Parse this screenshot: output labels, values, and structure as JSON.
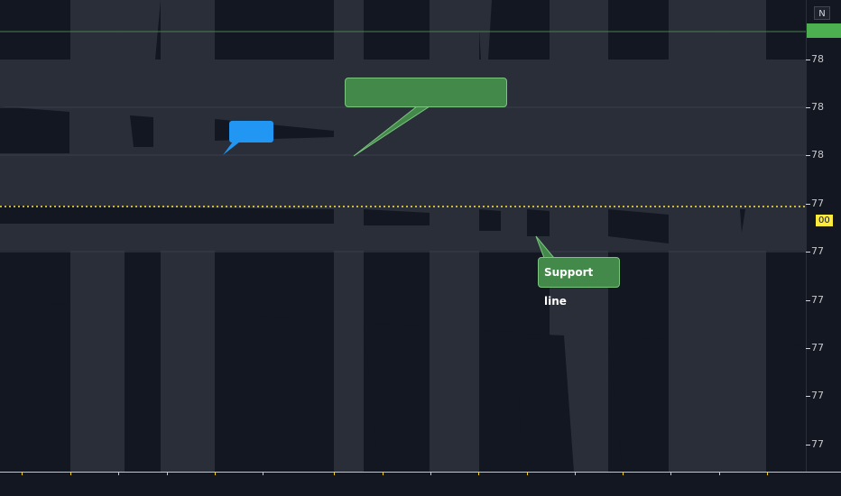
{
  "chart": {
    "price_scale": {
      "top_button": "N",
      "ticks": [
        "78",
        "78",
        "78",
        "77",
        "77",
        "77",
        "77",
        "77",
        "77"
      ],
      "current_price_tag": "00",
      "current_price_color": "#ffeb3b"
    },
    "callouts": {
      "blue_callout_text": "",
      "top_callout_text": "",
      "support_callout_text": "Support line"
    },
    "colors": {
      "background": "#131722",
      "band": "#2a2e39",
      "callout_green": "#43894a",
      "callout_blue": "#2196f3",
      "crosshair_line": "#ffeb3b",
      "axis_line": "#f5d21a"
    }
  }
}
